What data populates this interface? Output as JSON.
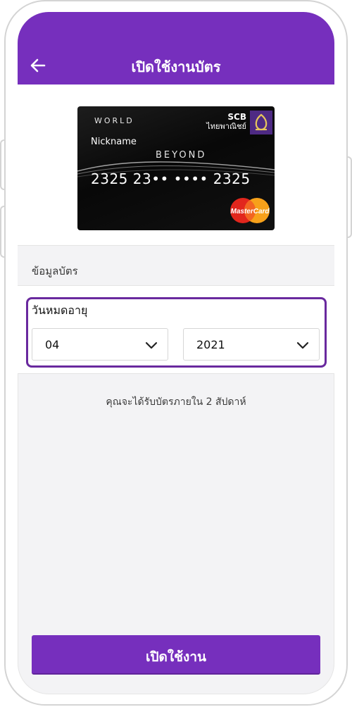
{
  "header": {
    "title": "เปิดใช้งานบัตร"
  },
  "card": {
    "tier": "WORLD",
    "bank_name": "SCB",
    "bank_name_thai": "ไทยพาณิชย์",
    "nickname": "Nickname",
    "product": "BEYOND",
    "number": "2325 23•• •••• 2325",
    "network": "MasterCard"
  },
  "section": {
    "label": "ข้อมูลบัตร"
  },
  "expiry": {
    "label": "วันหมดอายุ",
    "month": "04",
    "year": "2021"
  },
  "note": "คุณจะได้รับบัตรภายใน 2 สัปดาห์",
  "activate_button": "เปิดใช้งาน",
  "colors": {
    "brand": "#762fbd",
    "focus_border": "#69299e",
    "background": "#f3f3f5"
  },
  "icons": {
    "back": "arrow-left-icon",
    "dropdown": "chevron-down-icon"
  }
}
